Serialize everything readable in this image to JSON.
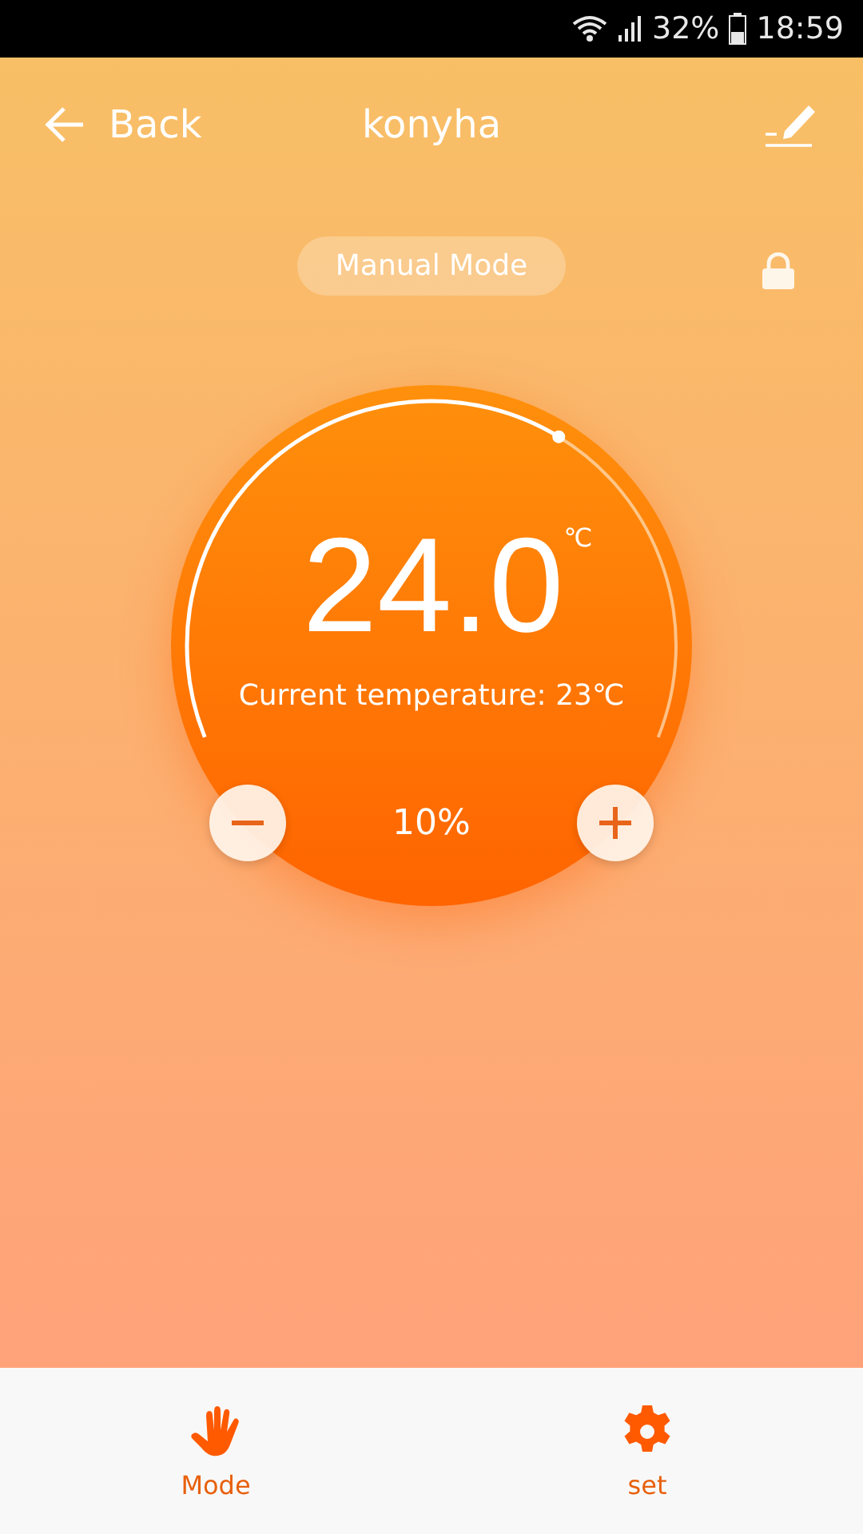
{
  "status_bar": {
    "battery": "32%",
    "time": "18:59"
  },
  "header": {
    "back": "Back",
    "title": "konyha"
  },
  "mode_badge": "Manual Mode",
  "dial": {
    "setpoint": "24.0",
    "unit": "℃",
    "current": "Current temperature: 23℃",
    "output": "10%"
  },
  "nav": [
    {
      "kind": "hand",
      "label": "Mode"
    },
    {
      "kind": "gear",
      "label": "set"
    }
  ]
}
